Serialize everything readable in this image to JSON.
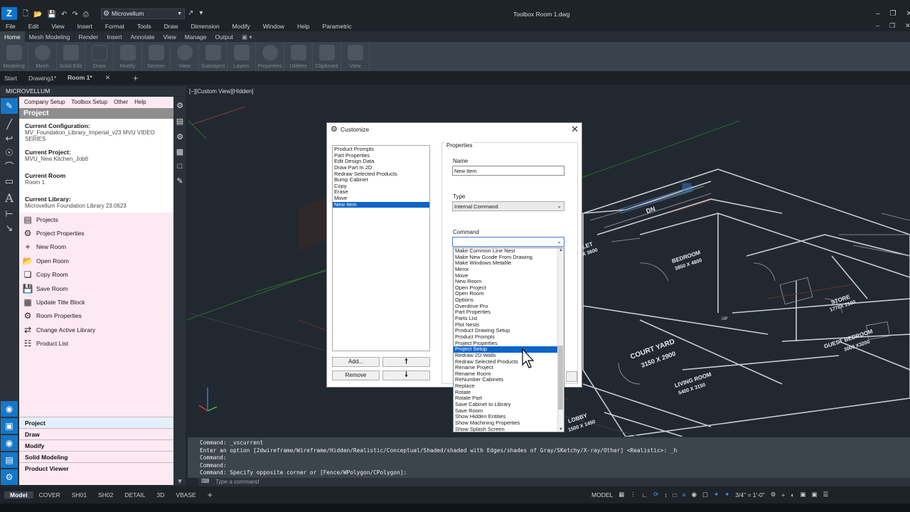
{
  "app": {
    "workspace": "Microvellum",
    "title": "Toolbox   Room 1.dwg",
    "logo": "Z"
  },
  "menubar": [
    "File",
    "Edit",
    "View",
    "Insert",
    "Format",
    "Tools",
    "Draw",
    "Dimension",
    "Modify",
    "Window",
    "Help",
    "Parametric"
  ],
  "ribbon_tabs": [
    "Home",
    "Mesh Modeling",
    "Render",
    "Insert",
    "Annotate",
    "View",
    "Manage",
    "Output"
  ],
  "ribbon_panels": [
    "Modeling",
    "Mesh",
    "Solid Edit",
    "Draw",
    "Modify",
    "Section",
    "View",
    "Subobject",
    "Layers",
    "Properties",
    "Utilities",
    "Clipboard",
    "View"
  ],
  "doc_tabs": [
    "Start",
    "Drawing1*",
    "Room 1*"
  ],
  "palette": {
    "header": "MICROVELLUM",
    "menu": [
      "Company Setup",
      "Toolbox Setup",
      "Other",
      "Help"
    ],
    "title": "Project",
    "current_configuration_label": "Current Configuration:",
    "current_configuration": "MV_Foundation_Library_Imperial_v23 MVU VIDEO SERIES",
    "current_project_label": "Current Project:",
    "current_project": "MVU_New Kitchen_Job6",
    "current_room_label": "Current Room",
    "current_room": "Room 1",
    "current_library_label": "Current Library:",
    "current_library": "Microvellum Foundation Library 23.0623",
    "commands": [
      {
        "label": "Projects",
        "icon": "projects-icon"
      },
      {
        "label": "Project Properties",
        "icon": "gear-icon"
      },
      {
        "label": "New Room",
        "icon": "plus-icon"
      },
      {
        "label": "Open Room",
        "icon": "folder-icon"
      },
      {
        "label": "Copy Room",
        "icon": "copy-icon"
      },
      {
        "label": "Save Room",
        "icon": "save-icon"
      },
      {
        "label": "Update Title Block",
        "icon": "title-block-icon"
      },
      {
        "label": "Room Properties",
        "icon": "gear-icon"
      },
      {
        "label": "Change Active Library",
        "icon": "swap-icon"
      },
      {
        "label": "Product List",
        "icon": "list-icon"
      }
    ],
    "sections": [
      "Project",
      "Draw",
      "Modify",
      "Solid Modeling",
      "Product Viewer"
    ]
  },
  "viewport": {
    "label": "[−][Custom View][Hidden]",
    "plan_texts": [
      "BEDROOM",
      "3850 X 4800",
      "STORE",
      "1770X 2100",
      "COURT YARD",
      "3150 X 2900",
      "GUEST BEDROOM",
      "3000 X3200",
      "LIVING ROOM",
      "5400 X 3150",
      "DN",
      "UP",
      "LOBBY",
      "1500 X 1450",
      "LET",
      "X 3600"
    ]
  },
  "dialog": {
    "title": "Customize",
    "items": [
      "Product Prompts",
      "Part Properties",
      "Edit Design Data",
      "Draw Part In 2D",
      "Redraw Selected Products",
      "Bump Cabinet",
      "Copy",
      "Erase",
      "Move",
      "New Item"
    ],
    "selected_item": "New Item",
    "add_label": "Add...",
    "remove_label": "Remove",
    "properties_label": "Properties",
    "name_label": "Name",
    "name_value": "New Item",
    "type_label": "Type",
    "type_value": "Internal Command",
    "command_label": "Command"
  },
  "command_dropdown": {
    "options": [
      "Make Common Line Nest",
      "Make New Gcode From Drawing",
      "Make Windows Metafile",
      "Mirror",
      "Move",
      "New Room",
      "Open Project",
      "Open Room",
      "Options",
      "Overdrive Pro",
      "Part Properties",
      "Parts List",
      "Plot Nests",
      "Product Drawing Setup",
      "Product Prompts",
      "Project Properties",
      "Project Setup",
      "Redraw 2D Walls",
      "Redraw Selected Products",
      "Rename Project",
      "Rename Room",
      "ReNumber Cabinets",
      "Replace",
      "Rotate",
      "Rotate Part",
      "Save Cabinet to Library",
      "Save Room",
      "Show Hidden Entities",
      "Show Machining Properties",
      "Show Splash Screen"
    ],
    "highlighted": "Project Setup"
  },
  "command_line": {
    "lines": [
      "Command: _vscurrent",
      "Enter an option [2dwireframe/Wireframe/Hidden/Realistic/Conceptual/Shaded/shaded with Edges/shades of Gray/SKetchy/X-ray/Other] <Realistic>: _h",
      "Command:",
      "Command:",
      "Command: Specify opposite corner or [Fence/WPolygon/CPolygon]:"
    ],
    "placeholder": "Type a command"
  },
  "status": {
    "layout_tabs": [
      "Model",
      "COVER",
      "SH01",
      "SH02",
      "DETAIL",
      "3D",
      "VBASE"
    ],
    "model_label": "MODEL",
    "scale": "3/4\" = 1'-0\""
  },
  "colors": {
    "accent": "#1577c8",
    "palette_bg": "#fde9f2",
    "viewport_bg": "#212830",
    "plan_lines": "#c8ccd2",
    "plan_red": "#8b3a3a",
    "selection": "#0a64c8"
  }
}
